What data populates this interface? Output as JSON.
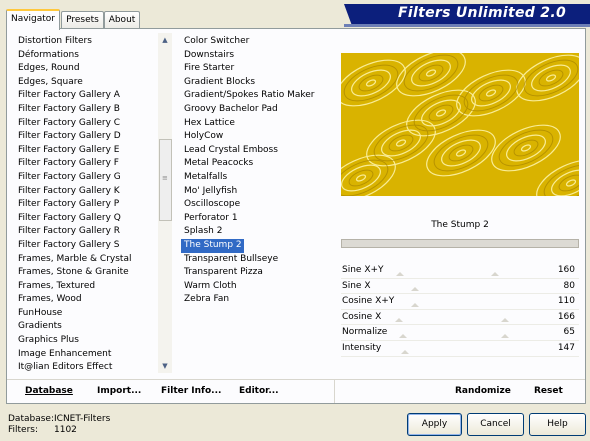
{
  "tabs": [
    "Navigator",
    "Presets",
    "About"
  ],
  "banner": "Filters Unlimited 2.0",
  "categories": [
    "Distortion Filters",
    "Déformations",
    "Edges, Round",
    "Edges, Square",
    "Filter Factory Gallery A",
    "Filter Factory Gallery B",
    "Filter Factory Gallery C",
    "Filter Factory Gallery D",
    "Filter Factory Gallery E",
    "Filter Factory Gallery F",
    "Filter Factory Gallery G",
    "Filter Factory Gallery K",
    "Filter Factory Gallery P",
    "Filter Factory Gallery Q",
    "Filter Factory Gallery R",
    "Filter Factory Gallery S",
    "Frames, Marble & Crystal",
    "Frames, Stone & Granite",
    "Frames, Textured",
    "Frames, Wood",
    "FunHouse",
    "Gradients",
    "Graphics Plus",
    "Image Enhancement",
    "It@lian Editors Effect"
  ],
  "filters": [
    "Color Switcher",
    "Downstairs",
    "Fire Starter",
    "Gradient Blocks",
    "Gradient/Spokes Ratio Maker",
    "Groovy Bachelor Pad",
    "Hex Lattice",
    "HolyCow",
    "Lead Crystal Emboss",
    "Metal Peacocks",
    "Metalfalls",
    "Mo' Jellyfish",
    "Oscilloscope",
    "Perforator 1",
    "Splash 2",
    "The Stump 2",
    "Transparent Bullseye",
    "Transparent Pizza",
    "Warm Cloth",
    "Zebra Fan"
  ],
  "selected_filter": "The Stump 2",
  "params": [
    {
      "name": "Sine X+Y",
      "value": "160"
    },
    {
      "name": "Sine X",
      "value": "80"
    },
    {
      "name": "Cosine X+Y",
      "value": "110"
    },
    {
      "name": "Cosine X",
      "value": "166"
    },
    {
      "name": "Normalize",
      "value": "65"
    },
    {
      "name": "Intensity",
      "value": "147"
    }
  ],
  "bottom_buttons": [
    "Database",
    "Import...",
    "Filter Info...",
    "Editor...",
    "Randomize",
    "Reset"
  ],
  "footer": {
    "database_label": "Database:",
    "database_value": "ICNET-Filters",
    "filters_label": "Filters:",
    "filters_value": "1102"
  },
  "dialog_buttons": [
    "Apply",
    "Cancel",
    "Help"
  ],
  "colors": {
    "selection": "#316ac5",
    "preview_base": "#e0b800",
    "banner": "#0c1f7c"
  }
}
